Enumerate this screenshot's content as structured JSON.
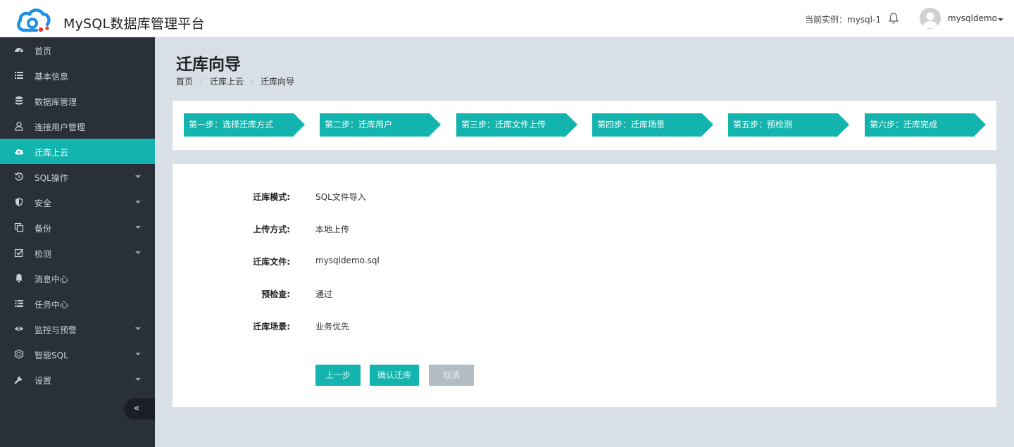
{
  "header": {
    "app_title": "MySQL数据库管理平台",
    "instance_text": "当前实例：mysql-1",
    "username": "mysqldemo"
  },
  "sidebar": {
    "items": [
      {
        "label": "首页",
        "icon": "dashboard-icon",
        "active": false,
        "caret": false
      },
      {
        "label": "基本信息",
        "icon": "list-icon",
        "active": false,
        "caret": false
      },
      {
        "label": "数据库管理",
        "icon": "database-icon",
        "active": false,
        "caret": false
      },
      {
        "label": "连接用户管理",
        "icon": "user-icon",
        "active": false,
        "caret": false
      },
      {
        "label": "迁库上云",
        "icon": "cloud-upload-icon",
        "active": true,
        "caret": false
      },
      {
        "label": "SQL操作",
        "icon": "history-icon",
        "active": false,
        "caret": true
      },
      {
        "label": "安全",
        "icon": "shield-icon",
        "active": false,
        "caret": true
      },
      {
        "label": "备份",
        "icon": "copy-icon",
        "active": false,
        "caret": true
      },
      {
        "label": "检测",
        "icon": "check-square-icon",
        "active": false,
        "caret": true
      },
      {
        "label": "消息中心",
        "icon": "bell-icon",
        "active": false,
        "caret": false
      },
      {
        "label": "任务中心",
        "icon": "tasks-icon",
        "active": false,
        "caret": false
      },
      {
        "label": "监控与预警",
        "icon": "eye-icon",
        "active": false,
        "caret": true
      },
      {
        "label": "智能SQL",
        "icon": "hexagon-icon",
        "active": false,
        "caret": true
      },
      {
        "label": "设置",
        "icon": "wrench-icon",
        "active": false,
        "caret": true
      }
    ],
    "collapse_glyph": "«"
  },
  "page": {
    "title": "迁库向导",
    "breadcrumb": [
      "首页",
      "迁库上云",
      "迁库向导"
    ],
    "breadcrumb_sep": "/"
  },
  "steps": [
    "第一步：选择迁库方式",
    "第二步：迁库用户",
    "第三步：迁库文件上传",
    "第四步：迁库场景",
    "第五步：预检测",
    "第六步：迁库完成"
  ],
  "form": {
    "rows": [
      {
        "label": "迁库模式:",
        "value": "SQL文件导入"
      },
      {
        "label": "上传方式:",
        "value": "本地上传"
      },
      {
        "label": "迁库文件:",
        "value": "mysqldemo.sql"
      },
      {
        "label": "预检查:",
        "value": "通过"
      },
      {
        "label": "迁库场景:",
        "value": "业务优先"
      }
    ],
    "buttons": {
      "prev": "上一步",
      "confirm": "确认迁库",
      "cancel": "取消"
    }
  },
  "colors": {
    "accent": "#14b4ae",
    "sidebar_bg": "#2a3038",
    "page_bg": "#d8dfe6"
  }
}
